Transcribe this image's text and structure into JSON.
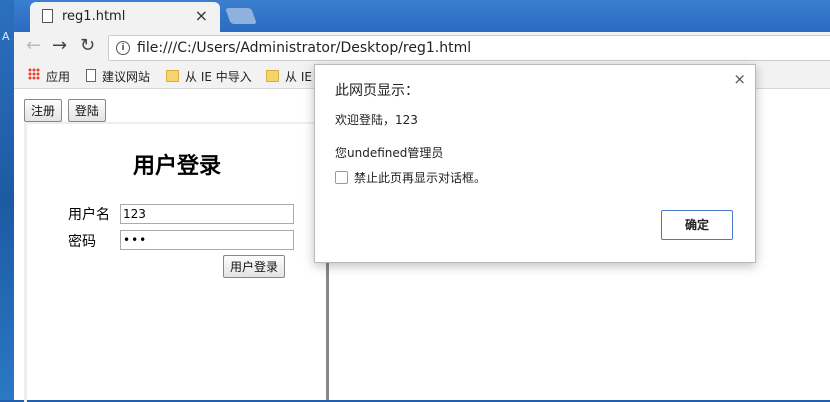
{
  "desktop": {
    "glyph": "A"
  },
  "tab": {
    "title": "reg1.html",
    "close": "×"
  },
  "toolbar": {
    "back": "←",
    "forward": "→",
    "reload": "↻",
    "info": "i",
    "url": "file:///C:/Users/Administrator/Desktop/reg1.html"
  },
  "bookmarks": {
    "apps": "应用",
    "item1": "建议网站",
    "item2": "从 IE 中导入",
    "item3": "从 IE"
  },
  "page": {
    "register_button": "注册",
    "login_button": "登陆",
    "title": "用户登录",
    "username_label": "用户名",
    "username_value": "123",
    "password_label": "密码",
    "password_value": "•••",
    "submit_button": "用户登录"
  },
  "dialog": {
    "title": "此网页显示：",
    "close": "×",
    "message1": "欢迎登陆，123",
    "message2": "您undefined管理员",
    "checkbox_label": "禁止此页再显示对话框。",
    "ok_button": "确定"
  }
}
